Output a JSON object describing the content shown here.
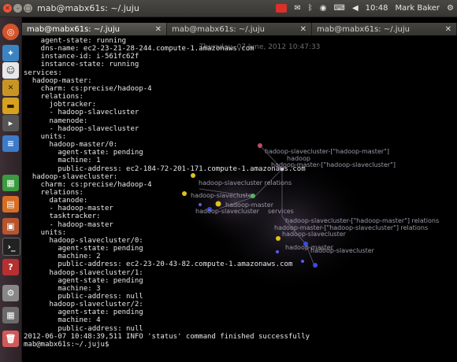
{
  "window": {
    "title": "mab@mabx61s: ~/.juju"
  },
  "indicators": {
    "time": "10:48",
    "user": "Mark Baker"
  },
  "tabs": [
    {
      "label": "mab@mabx61s: ~/.juju",
      "active": true
    },
    {
      "label": "mab@mabx61s: ~/.juju",
      "active": false
    },
    {
      "label": "mab@mabx61s: ~/.juju",
      "active": false
    }
  ],
  "terminal": {
    "lines": [
      "    agent-state: running",
      "    dns-name: ec2-23-21-28-244.compute-1.amazonaws.com",
      "    instance-id: i-561fc62f",
      "    instance-state: running",
      "services:",
      "  hadoop-master:",
      "    charm: cs:precise/hadoop-4",
      "    relations:",
      "      jobtracker:",
      "      - hadoop-slavecluster",
      "      namenode:",
      "      - hadoop-slavecluster",
      "    units:",
      "      hadoop-master/0:",
      "        agent-state: pending",
      "        machine: 1",
      "        public-address: ec2-184-72-201-171.compute-1.amazonaws.com",
      "  hadoop-slavecluster:",
      "    charm: cs:precise/hadoop-4",
      "    relations:",
      "      datanode:",
      "      - hadoop-master",
      "      tasktracker:",
      "      - hadoop-master",
      "    units:",
      "      hadoop-slavecluster/0:",
      "        agent-state: pending",
      "        machine: 2",
      "        public-address: ec2-23-20-43-82.compute-1.amazonaws.com",
      "      hadoop-slavecluster/1:",
      "        agent-state: pending",
      "        machine: 3",
      "        public-address: null",
      "      hadoop-slavecluster/2:",
      "        agent-state: pending",
      "        machine: 4",
      "        public-address: null",
      "2012-06-07 10:48:39,511 INFO 'status' command finished successfully",
      "mab@mabx61s:~/.juju$"
    ]
  },
  "overlay": {
    "timestamp": "Thursday, 07 June, 2012 10:47:33",
    "labels": [
      "hadoop-slavecluster-[\"hadoop-master\"]",
      "hadoop",
      "hadoop-master-[\"hadoop-slavecluster\"]",
      "hadoop-slavecluster relations",
      "hadoop-slavecluster",
      "hadoop-master",
      "hadoop-slavecluster",
      "services",
      "hadoop-slavecluster-[\"hadoop-master\"] relations",
      "hadoop-master-[\"hadoop-slavecluster\"] relations",
      "hadoop-slavecluster",
      "hadoop-master",
      "hadoop-slavecluster"
    ]
  },
  "launcher": {
    "icons": [
      "ubuntu-dash-icon",
      "bird-icon",
      "chat-icon",
      "burn-icon",
      "notes-icon",
      "files-icon",
      "document-icon",
      "spreadsheet-icon",
      "presentation-icon",
      "gift-icon",
      "terminal-icon",
      "help-icon",
      "settings-icon",
      "workspace-icon",
      "trash-icon"
    ]
  }
}
